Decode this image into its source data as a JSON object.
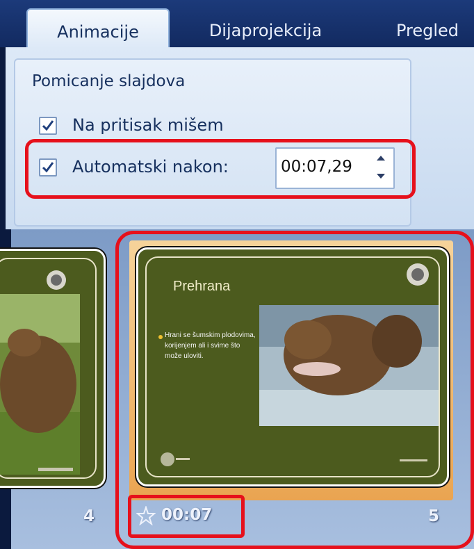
{
  "ribbon": {
    "tabs": [
      {
        "label": "Animacije",
        "active": true
      },
      {
        "label": "Dijaprojekcija",
        "active": false
      },
      {
        "label": "Pregled",
        "active": false
      }
    ],
    "group_title": "Pomicanje slajdova",
    "on_mouse_click": {
      "label": "Na pritisak mišem",
      "checked": true
    },
    "auto_after": {
      "label": "Automatski nakon:",
      "checked": true,
      "value": "00:07,29"
    }
  },
  "sorter": {
    "slides": [
      {
        "number": "4"
      },
      {
        "number": "5",
        "selected": true,
        "title": "Prehrana",
        "bullet": "Hrani se šumskim plodovima, korijenjem ali i svime što može uloviti.",
        "timing": "00:07"
      }
    ]
  },
  "colors": {
    "highlight": "#e6101b",
    "selection": "#eaa451",
    "slide_bg": "#4c5b1e"
  }
}
